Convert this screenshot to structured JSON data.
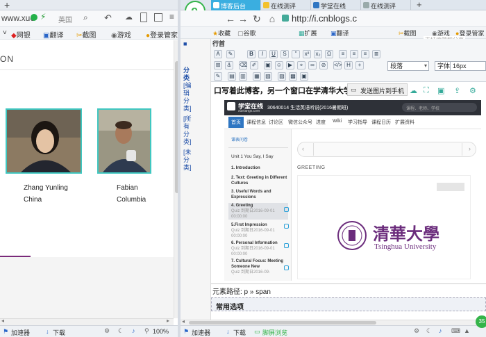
{
  "left_window": {
    "tab_add": "+",
    "address": "www.xue",
    "search_engine": "英国",
    "bookmarks": [
      "网银",
      "翻译",
      "截图",
      "游戏",
      "登录管家"
    ],
    "page_heading": "ON",
    "people": [
      {
        "name": "Zhang Yunling",
        "country": "China"
      },
      {
        "name": "Fabian",
        "country": "Columbia"
      }
    ],
    "status": {
      "accelerator": "加速器",
      "download": "下载",
      "zoom": "100%"
    }
  },
  "right_window": {
    "tabs": [
      "博客后台",
      "在线测评",
      "学堂在线",
      "在线测评",
      "+"
    ],
    "address": "http://i.cnblogs.c",
    "bookmarks": [
      "收藏",
      "谷歌",
      "扩展",
      "翻译",
      "截图",
      "游戏",
      "登录管家"
    ],
    "hint_overlay": "支持涂鸦和分享",
    "editor": {
      "toolbar_row1_text": "行首",
      "paragraph_select": "段落",
      "font_select": "字体",
      "size_select": "16px",
      "title_text": "口写着此博客，另一个窗口在学清华大学",
      "send_image_label": "发送图片到手机",
      "left_nav": {
        "heading": "分类",
        "links": [
          "[编辑分类]",
          "[所有分类]",
          "[未分类]"
        ]
      },
      "element_path": "元素路径: p » span",
      "common_options": "常用选项"
    },
    "xuetang": {
      "logo": "学堂在线",
      "logo_sub": "xuetangx.com",
      "course_title": "30640014 生活英语听说(2016暑期班)",
      "search_placeholder": "课程、老师、学校",
      "nav": [
        "首页",
        "课程信息",
        "讨论区",
        "微信公众号",
        "进度",
        "Wiki",
        "学习指导",
        "课程日历",
        "扩展资料"
      ],
      "side_back": "课表问卷",
      "unit": "Unit 1 You Say, I Say",
      "lessons": [
        {
          "title": "1. Introduction",
          "sub": ""
        },
        {
          "title": "2. Text: Greeting in Different Cultures",
          "sub": ""
        },
        {
          "title": "3. Useful Words and Expressions",
          "sub": ""
        },
        {
          "title": "4. Greeting",
          "sub": "Quiz 到期日2016-09-01 00:00:00"
        },
        {
          "title": "5.First Impression",
          "sub": "Quiz 到期日2016-09-01 00:00:00"
        },
        {
          "title": "6. Personal Information",
          "sub": "Quiz 到期日2016-09-01 00:00:00"
        },
        {
          "title": "7. Cultural Focus: Meeting Someone New",
          "sub": "Quiz 到期日2016-09-"
        }
      ],
      "section_title": "GREETING",
      "university_cn": "清華大學",
      "university_en": "Tsinghua University"
    },
    "status": {
      "accelerator": "加速器",
      "download": "下载",
      "screen_button": "脚屏浏览"
    },
    "badge_count": "35"
  },
  "colors": {
    "accent_teal": "#3fc7c1",
    "tab_active": "#3aaee0",
    "tsinghua_purple": "#6b2c7c",
    "xt_blue": "#2f76c2"
  }
}
